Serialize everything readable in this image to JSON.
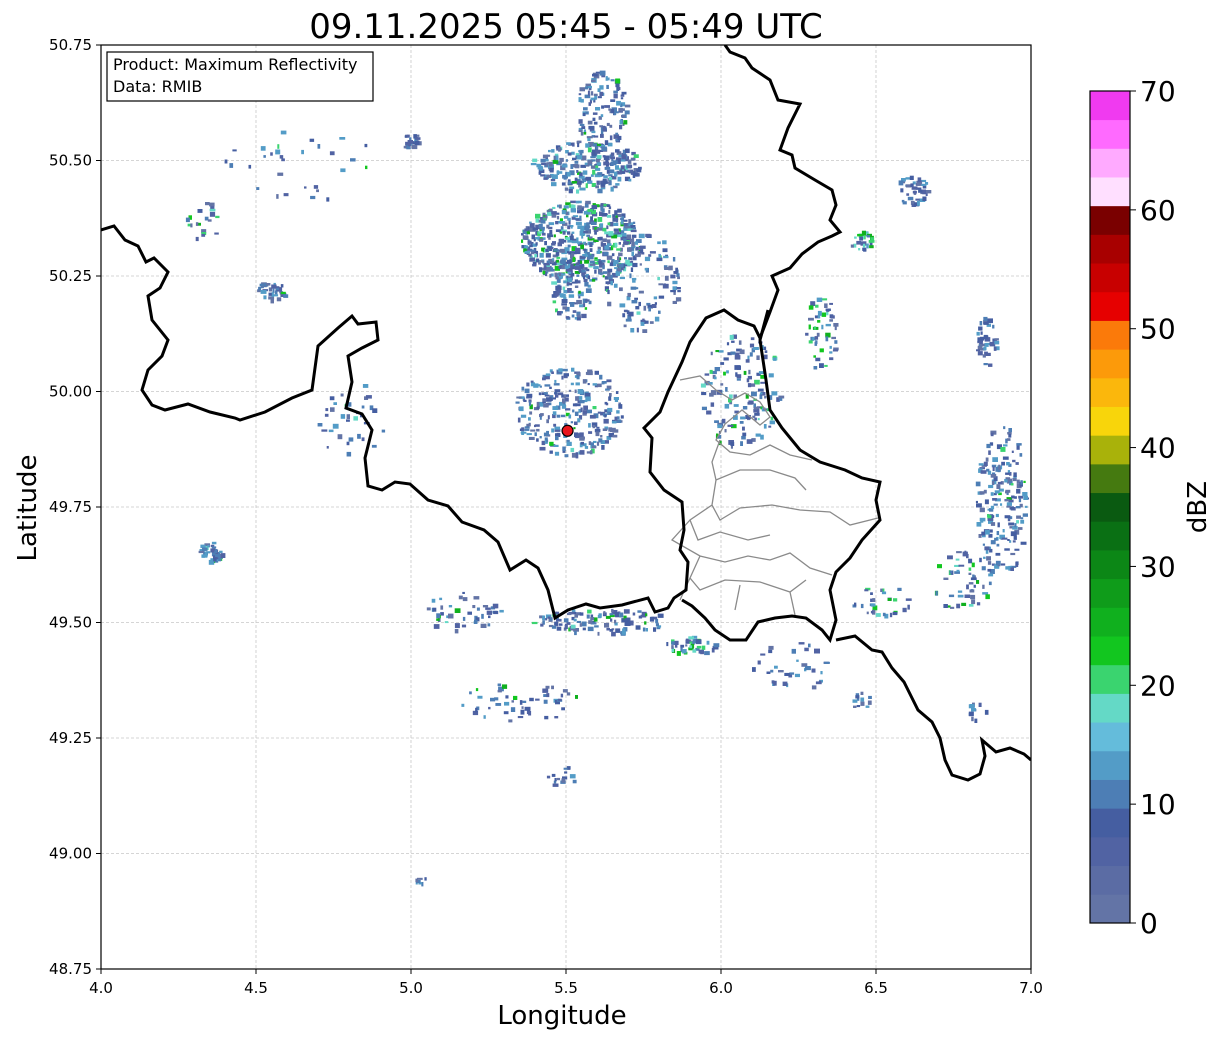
{
  "title": "09.11.2025 05:45 - 05:49 UTC",
  "info_box": {
    "product_line": "Product: Maximum Reflectivity",
    "data_line": "Data: RMIB"
  },
  "map": {
    "type": "radar_reflectivity_map",
    "xlabel": "Longitude",
    "ylabel": "Latitude",
    "xlim": [
      4.0,
      7.0
    ],
    "ylim": [
      48.75,
      50.75
    ],
    "x_ticks": [
      "4.0",
      "4.5",
      "5.0",
      "5.5",
      "6.0",
      "6.5",
      "7.0"
    ],
    "y_ticks": [
      "48.75",
      "49.00",
      "49.25",
      "49.50",
      "49.75",
      "50.00",
      "50.25",
      "50.50",
      "50.75"
    ],
    "grid": true,
    "radar_site": {
      "lon": 5.505,
      "lat": 49.915,
      "color": "#e8161c"
    },
    "country_border_color": "#000000",
    "admin_border_color": "#8a8a8a"
  },
  "colorbar": {
    "label": "dBZ",
    "min": 0,
    "max": 70,
    "step": 2.5,
    "tick_labels": [
      "0",
      "10",
      "20",
      "30",
      "40",
      "50",
      "60",
      "70"
    ],
    "colors": [
      "#6374a6",
      "#5b6ca4",
      "#5163a3",
      "#455ea1",
      "#4d7eb5",
      "#539cc7",
      "#64bcdb",
      "#64d9c6",
      "#3ad46f",
      "#12c61f",
      "#10b01e",
      "#0f9c1a",
      "#0c8716",
      "#0a7014",
      "#0a5a11",
      "#457a10",
      "#a9b20a",
      "#f8d50b",
      "#fbb70c",
      "#fc9a0a",
      "#fb7a0a",
      "#e60000",
      "#c80000",
      "#a80000",
      "#7a0000",
      "#ffdfff",
      "#ffaaff",
      "#ff6aff",
      "#f03af0"
    ]
  }
}
